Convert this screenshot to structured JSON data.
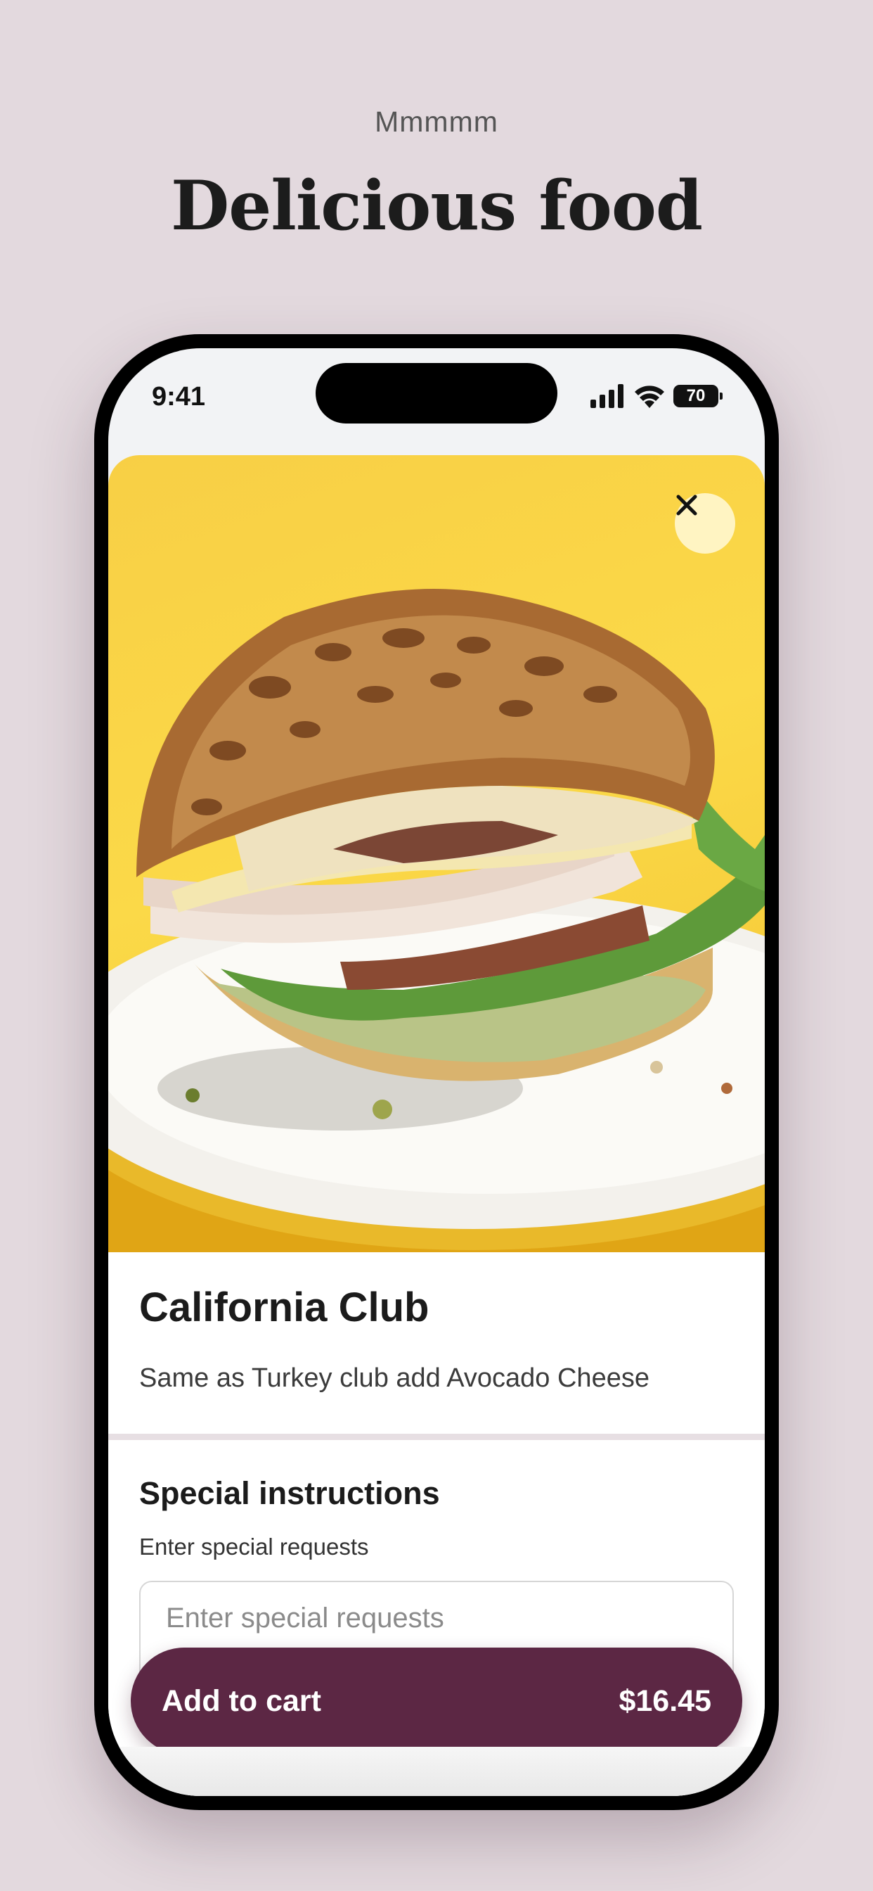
{
  "page": {
    "kicker": "Mmmmm",
    "headline": "Delicious food"
  },
  "status_bar": {
    "time": "9:41",
    "battery": "70",
    "icons": [
      "signal-icon",
      "wifi-icon",
      "battery-icon"
    ]
  },
  "item": {
    "image_alt": "California Club sandwich on a plate",
    "name": "California Club",
    "description": "Same as Turkey club add Avocado Cheese",
    "close_icon": "close-icon"
  },
  "special_instructions": {
    "title": "Special instructions",
    "subtitle": "Enter special requests",
    "placeholder": "Enter special requests"
  },
  "cart": {
    "label": "Add to cart",
    "price": "$16.45"
  },
  "colors": {
    "background": "#e3d9de",
    "accent": "#5c2744",
    "hero": "#f8cf45"
  }
}
